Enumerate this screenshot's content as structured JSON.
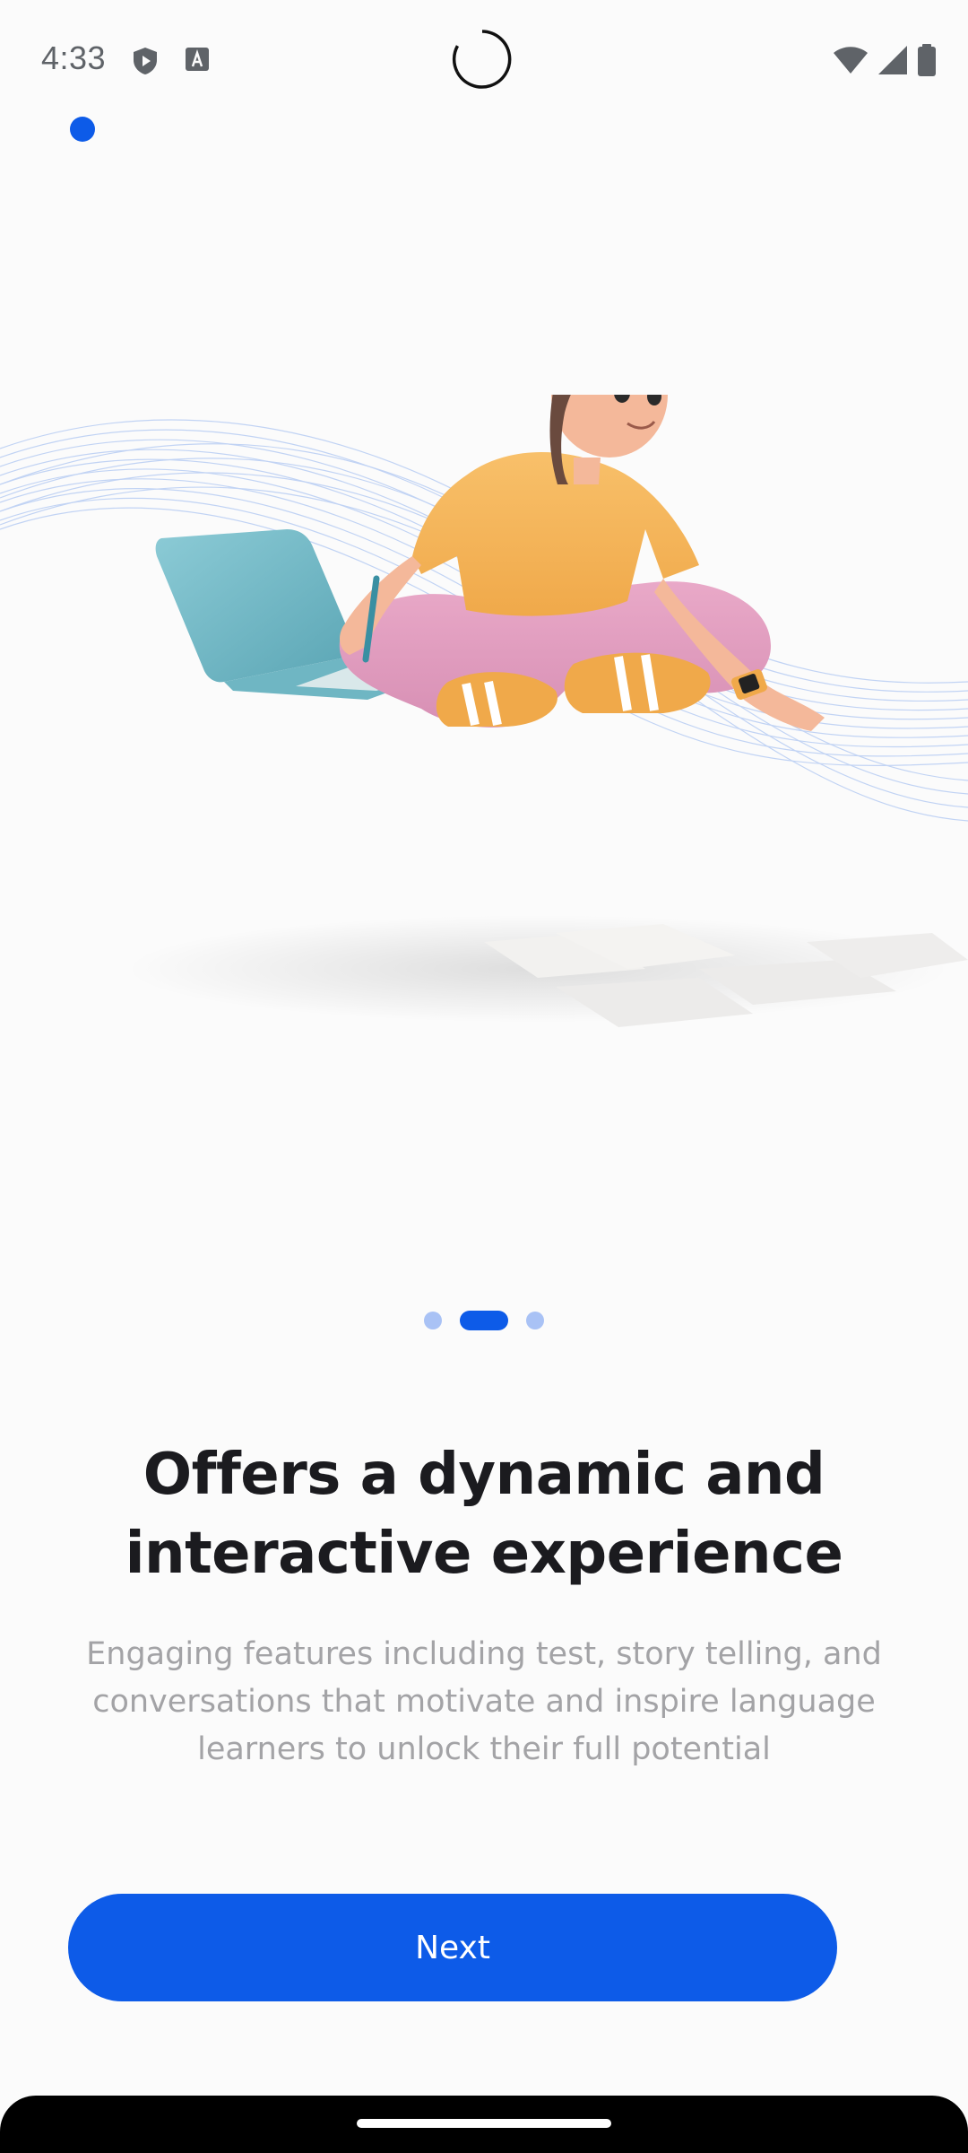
{
  "status_bar": {
    "time": "4:33",
    "icons_left": [
      "shield-play-icon",
      "font-a-icon"
    ],
    "icons_right": [
      "wifi-icon",
      "cellular-signal-icon",
      "battery-icon"
    ]
  },
  "onboarding": {
    "illustration": "person-sitting-with-laptop-illustration",
    "pager": {
      "count": 3,
      "active_index": 1
    },
    "headline": "Offers a dynamic and interactive experience",
    "description": "Engaging features including test, story telling, and conversations that motivate and inspire language learners to unlock their full potential",
    "next_label": "Next"
  },
  "colors": {
    "accent": "#0d5be8",
    "pager_inactive": "#a9c2f5",
    "headline": "#1b1b1f",
    "description": "#a3a3a6",
    "background": "#fbfbfb"
  }
}
